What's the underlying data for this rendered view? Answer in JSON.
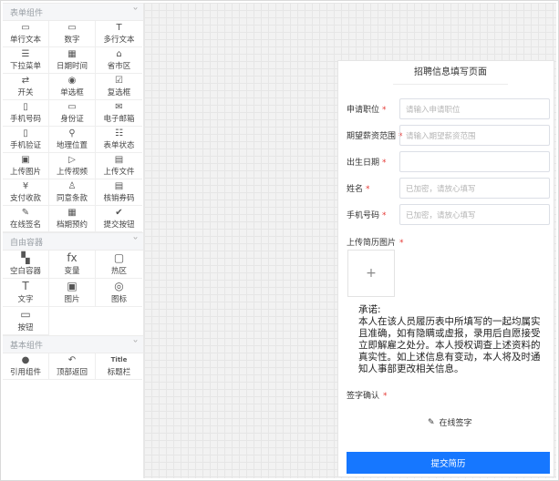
{
  "sidebar": {
    "groups": [
      {
        "title": "表单组件",
        "items": [
          {
            "icon": "▭",
            "label": "单行文本"
          },
          {
            "icon": "▭",
            "label": "数字"
          },
          {
            "icon": "T",
            "label": "多行文本"
          },
          {
            "icon": "☰",
            "label": "下拉菜单"
          },
          {
            "icon": "▦",
            "label": "日期时间"
          },
          {
            "icon": "⌂",
            "label": "省市区"
          },
          {
            "icon": "⇄",
            "label": "开关"
          },
          {
            "icon": "◉",
            "label": "单选框"
          },
          {
            "icon": "☑",
            "label": "复选框"
          },
          {
            "icon": "▯",
            "label": "手机号码"
          },
          {
            "icon": "▭",
            "label": "身份证"
          },
          {
            "icon": "✉",
            "label": "电子邮箱"
          },
          {
            "icon": "▯",
            "label": "手机验证"
          },
          {
            "icon": "⚲",
            "label": "地理位置"
          },
          {
            "icon": "☷",
            "label": "表单状态"
          },
          {
            "icon": "▣",
            "label": "上传图片"
          },
          {
            "icon": "▷",
            "label": "上传视频"
          },
          {
            "icon": "▤",
            "label": "上传文件"
          },
          {
            "icon": "¥",
            "label": "支付收款"
          },
          {
            "icon": "♙",
            "label": "同意条款"
          },
          {
            "icon": "▤",
            "label": "核销券码"
          },
          {
            "icon": "✎",
            "label": "在线签名"
          },
          {
            "icon": "▦",
            "label": "档期预约"
          },
          {
            "icon": "✔",
            "label": "提交按钮"
          }
        ]
      },
      {
        "title": "自由容器",
        "items": [
          {
            "icon": "▚",
            "label": "空白容器"
          },
          {
            "icon": "fx",
            "label": "变量"
          },
          {
            "icon": "▢",
            "label": "热区"
          },
          {
            "icon": "T",
            "label": "文字"
          },
          {
            "icon": "▣",
            "label": "图片"
          },
          {
            "icon": "◎",
            "label": "图标"
          },
          {
            "icon": "▭",
            "label": "按钮"
          }
        ]
      },
      {
        "title": "基本组件",
        "items": [
          {
            "icon": "●",
            "label": "引用组件"
          },
          {
            "icon": "↶",
            "label": "顶部返回"
          },
          {
            "icon": "Title",
            "label": "标题栏"
          }
        ]
      }
    ]
  },
  "form": {
    "title": "招聘信息填写页面",
    "fields": [
      {
        "label": "申请职位",
        "placeholder": "请输入申请职位"
      },
      {
        "label": "期望薪资范围",
        "placeholder": "请输入期望薪资范围"
      },
      {
        "label": "出生日期",
        "placeholder": ""
      },
      {
        "label": "姓名",
        "placeholder": "已加密，请放心填写"
      },
      {
        "label": "手机号码",
        "placeholder": "已加密，请放心填写"
      }
    ],
    "upload_label": "上传简历图片",
    "upload_plus": "+",
    "promise_title": "承诺:",
    "promise_body": "本人在该人员履历表中所填写的一起均属实且准确，如有隐瞒或虚报，录用后自愿接受立即解雇之处分。本人授权调查上述资料的真实性。如上述信息有变动，本人将及时通知人事部更改相关信息。",
    "sign_label": "签字确认",
    "sign_button": "在线签字",
    "sign_icon": "✎",
    "submit": "提交简历",
    "required_mark": "*"
  }
}
